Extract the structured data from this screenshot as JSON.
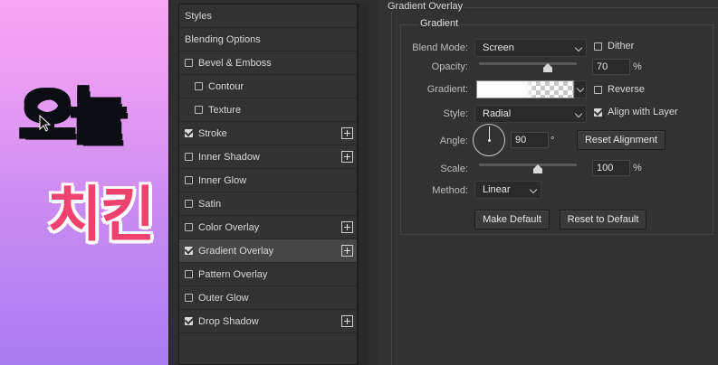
{
  "canvas": {
    "word1": "오늘",
    "word2": "치킨",
    "cursor_icon": "move-cursor-icon"
  },
  "styles_list": {
    "items": [
      {
        "label": "Styles",
        "checkbox": false,
        "checked": false,
        "plus": false,
        "indent": false,
        "selected": false
      },
      {
        "label": "Blending Options",
        "checkbox": false,
        "checked": false,
        "plus": false,
        "indent": false,
        "selected": false
      },
      {
        "label": "Bevel & Emboss",
        "checkbox": true,
        "checked": false,
        "plus": false,
        "indent": false,
        "selected": false
      },
      {
        "label": "Contour",
        "checkbox": true,
        "checked": false,
        "plus": false,
        "indent": true,
        "selected": false
      },
      {
        "label": "Texture",
        "checkbox": true,
        "checked": false,
        "plus": false,
        "indent": true,
        "selected": false
      },
      {
        "label": "Stroke",
        "checkbox": true,
        "checked": true,
        "plus": true,
        "indent": false,
        "selected": false
      },
      {
        "label": "Inner Shadow",
        "checkbox": true,
        "checked": false,
        "plus": true,
        "indent": false,
        "selected": false
      },
      {
        "label": "Inner Glow",
        "checkbox": true,
        "checked": false,
        "plus": false,
        "indent": false,
        "selected": false
      },
      {
        "label": "Satin",
        "checkbox": true,
        "checked": false,
        "plus": false,
        "indent": false,
        "selected": false
      },
      {
        "label": "Color Overlay",
        "checkbox": true,
        "checked": false,
        "plus": true,
        "indent": false,
        "selected": false
      },
      {
        "label": "Gradient Overlay",
        "checkbox": true,
        "checked": true,
        "plus": true,
        "indent": false,
        "selected": true
      },
      {
        "label": "Pattern Overlay",
        "checkbox": true,
        "checked": false,
        "plus": false,
        "indent": false,
        "selected": false
      },
      {
        "label": "Outer Glow",
        "checkbox": true,
        "checked": false,
        "plus": false,
        "indent": false,
        "selected": false
      },
      {
        "label": "Drop Shadow",
        "checkbox": true,
        "checked": true,
        "plus": true,
        "indent": false,
        "selected": false
      }
    ]
  },
  "settings": {
    "section_title": "Gradient Overlay",
    "group_title": "Gradient",
    "blend_mode": {
      "label": "Blend Mode:",
      "value": "Screen"
    },
    "dither": {
      "label": "Dither",
      "checked": false
    },
    "opacity": {
      "label": "Opacity:",
      "value": "70",
      "unit": "%",
      "level": 0.7
    },
    "gradient": {
      "label": "Gradient:"
    },
    "reverse": {
      "label": "Reverse",
      "checked": false
    },
    "style": {
      "label": "Style:",
      "value": "Radial"
    },
    "align_with_layer": {
      "label": "Align with Layer",
      "checked": true
    },
    "angle": {
      "label": "Angle:",
      "value": "90",
      "unit": "°"
    },
    "reset_alignment_label": "Reset Alignment",
    "scale": {
      "label": "Scale:",
      "value": "100",
      "unit": "%",
      "level": 0.6
    },
    "method": {
      "label": "Method:",
      "value": "Linear"
    },
    "make_default_label": "Make Default",
    "reset_default_label": "Reset to Default"
  }
}
